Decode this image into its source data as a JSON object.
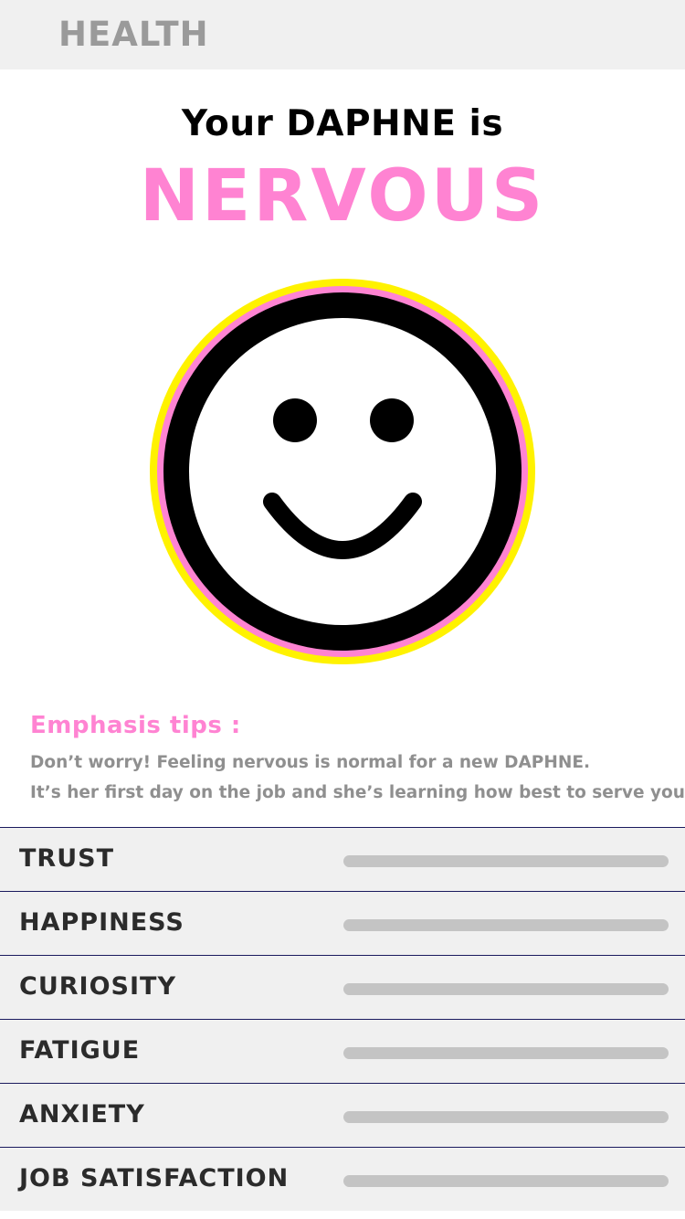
{
  "header": {
    "title": "HEALTH"
  },
  "status": {
    "headline": "Your DAPHNE is",
    "mood": "NERVOUS",
    "face_icon": "smiley-face-icon"
  },
  "tips": {
    "title": "Emphasis tips :",
    "lines": [
      "Don’t worry! Feeling nervous is normal for a new DAPHNE.",
      "It’s her first day on the job and she’s learning how best to serve you."
    ]
  },
  "metrics": [
    {
      "label": "TRUST",
      "value": 0
    },
    {
      "label": "HAPPINESS",
      "value": 0
    },
    {
      "label": "CURIOSITY",
      "value": 0
    },
    {
      "label": "FATIGUE",
      "value": 0
    },
    {
      "label": "ANXIETY",
      "value": 0
    },
    {
      "label": "JOB SATISFACTION",
      "value": 0
    }
  ],
  "colors": {
    "accent_pink": "#ff83d2",
    "ring_yellow": "#fff200",
    "header_bg": "#f0f0f0",
    "divider_navy": "#1a1a5e",
    "bar_track": "#c4c4c4"
  }
}
